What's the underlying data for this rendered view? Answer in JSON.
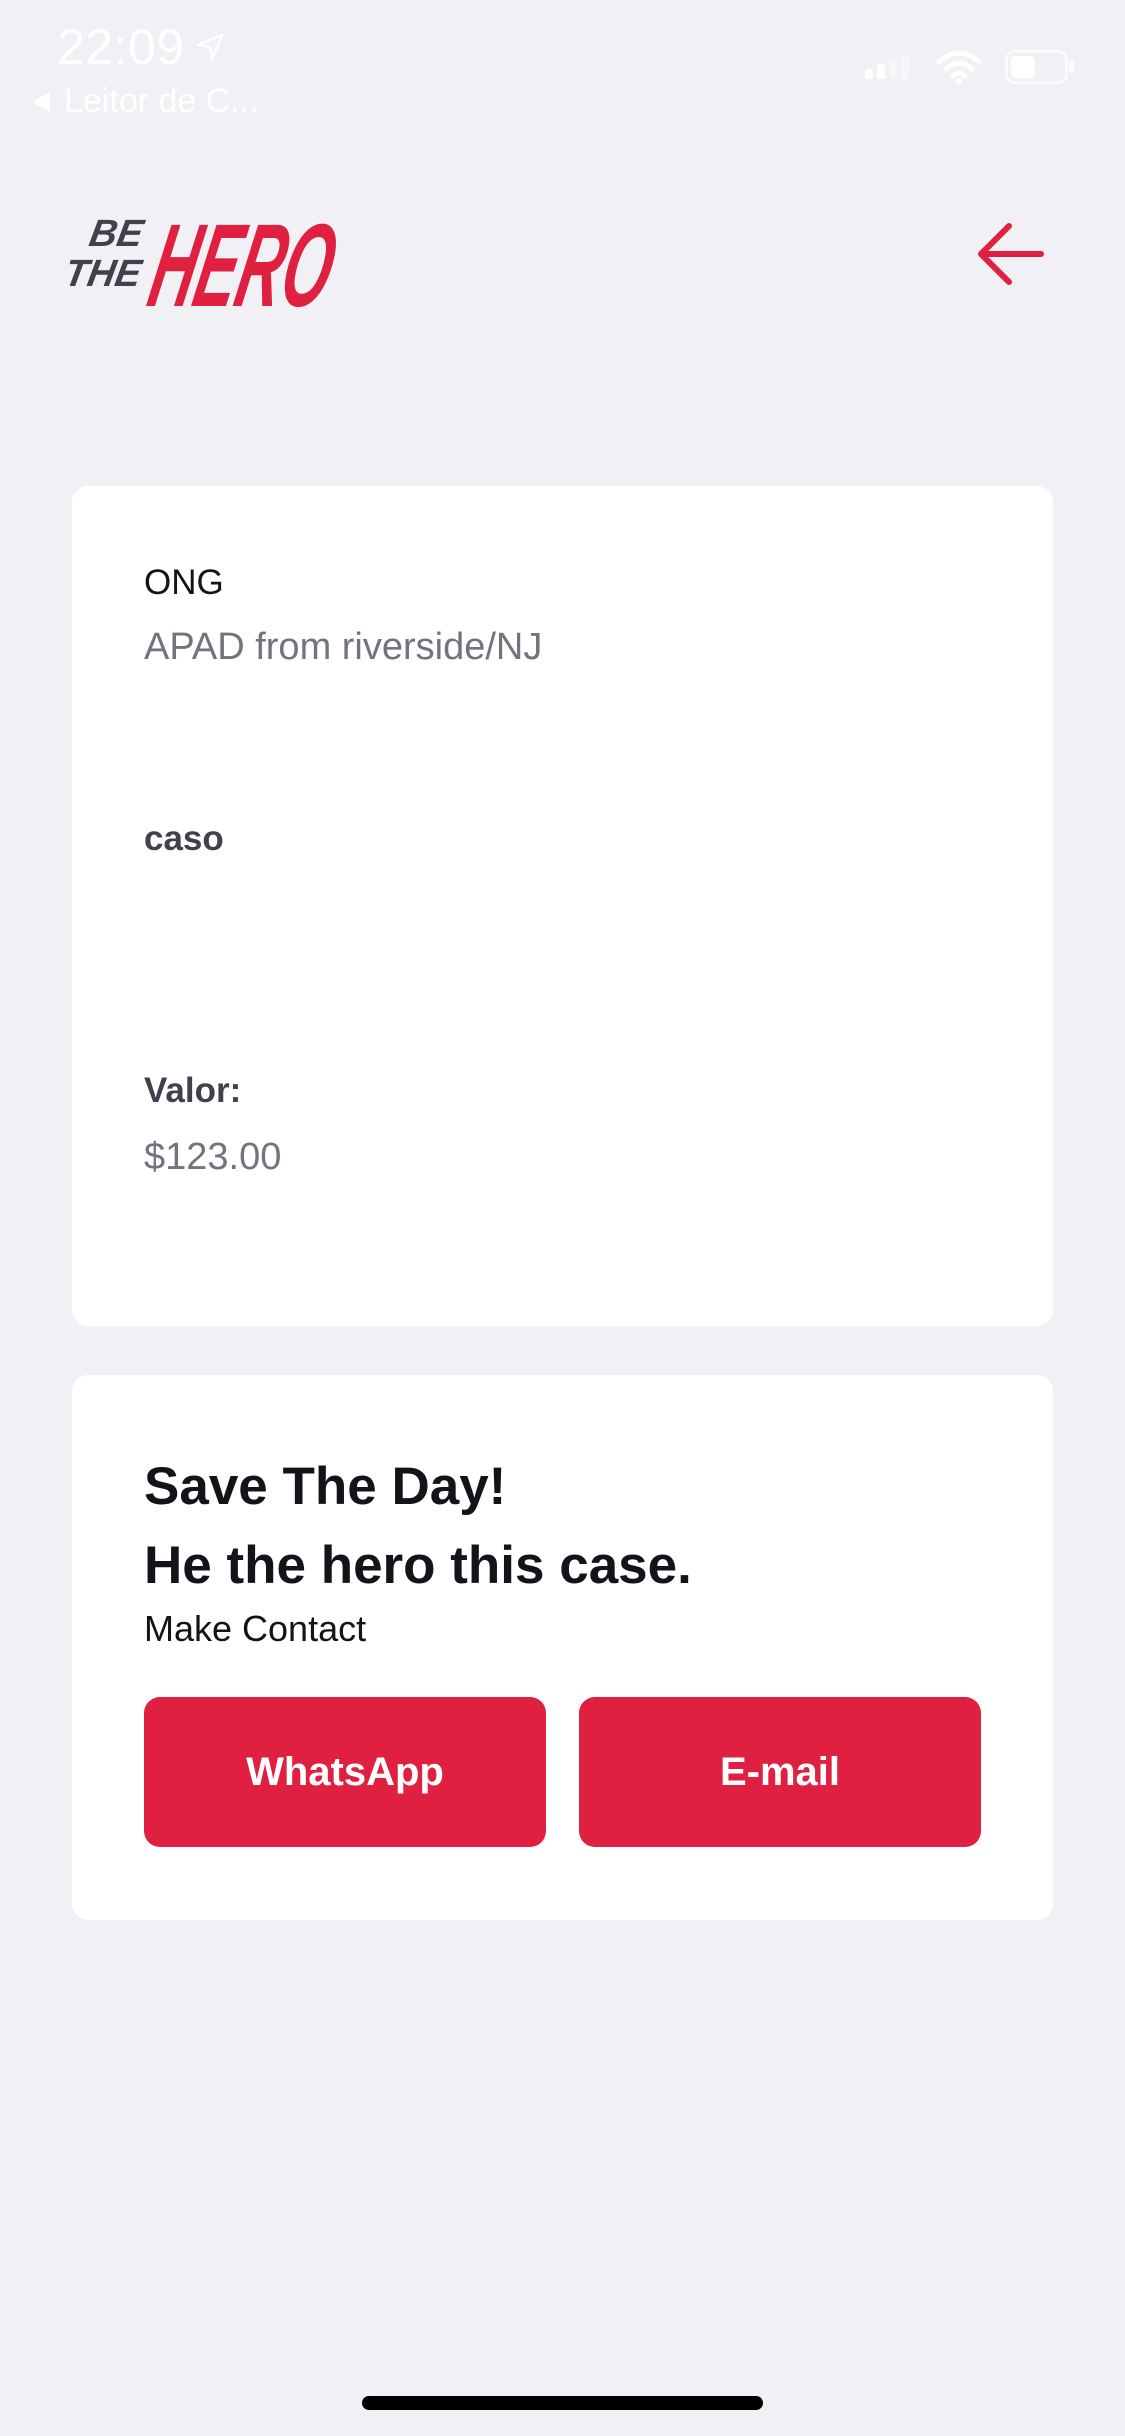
{
  "status_bar": {
    "time": "22:09",
    "back_app": "Leitor de C..."
  },
  "header": {
    "logo_text_small_1": "BE",
    "logo_text_small_2": "THE",
    "logo_text_big": "HERO"
  },
  "incident": {
    "ong_label": "ONG",
    "ong_value": "APAD from riverside/NJ",
    "case_label": "caso",
    "case_value": "",
    "value_label": "Valor:",
    "value_value": "$123.00"
  },
  "contact": {
    "title_line_1": "Save The Day!",
    "title_line_2": "He the hero this case.",
    "description": "Make Contact",
    "whatsapp_label": "WhatsApp",
    "email_label": "E-mail"
  },
  "colors": {
    "brand": "#e02041",
    "background": "#f0f0f5",
    "card": "#ffffff"
  },
  "icons": {
    "back": "arrow-left-icon",
    "location": "location-arrow-icon",
    "signal": "signal-icon",
    "wifi": "wifi-icon",
    "battery": "battery-icon"
  }
}
